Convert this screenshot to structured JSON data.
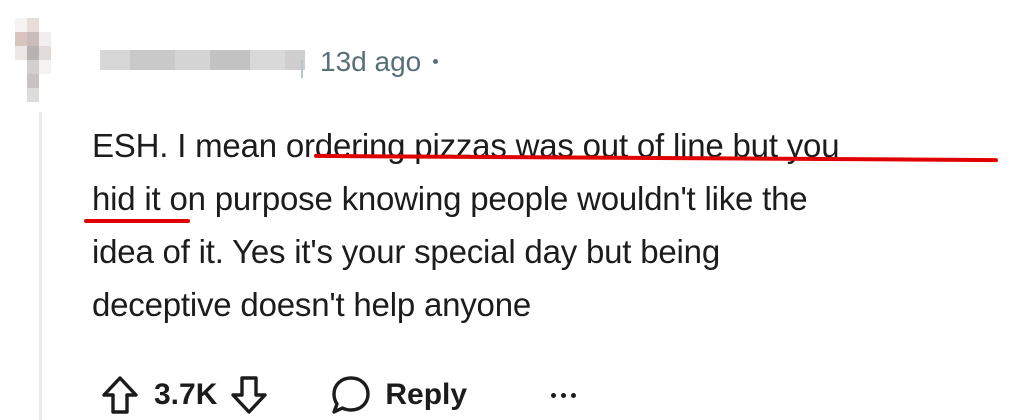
{
  "comment": {
    "timestamp": "13d ago",
    "lines": [
      "ESH. I mean ordering pizzas was out of line but you",
      "hid it on purpose knowing people wouldn't like the",
      "idea of it. Yes it's your special day but being",
      "deceptive doesn't help anyone"
    ]
  },
  "actions": {
    "vote_count": "3.7K",
    "reply_label": "Reply"
  },
  "icons": {
    "upvote": "arrow-up-outline-icon",
    "downvote": "arrow-down-outline-icon",
    "reply": "speech-bubble-icon",
    "more": "ellipsis-icon"
  },
  "colors": {
    "text": "#1c1c1c",
    "meta": "#576f76",
    "annotation": "#e00000",
    "thread_line": "#e5ebee"
  }
}
